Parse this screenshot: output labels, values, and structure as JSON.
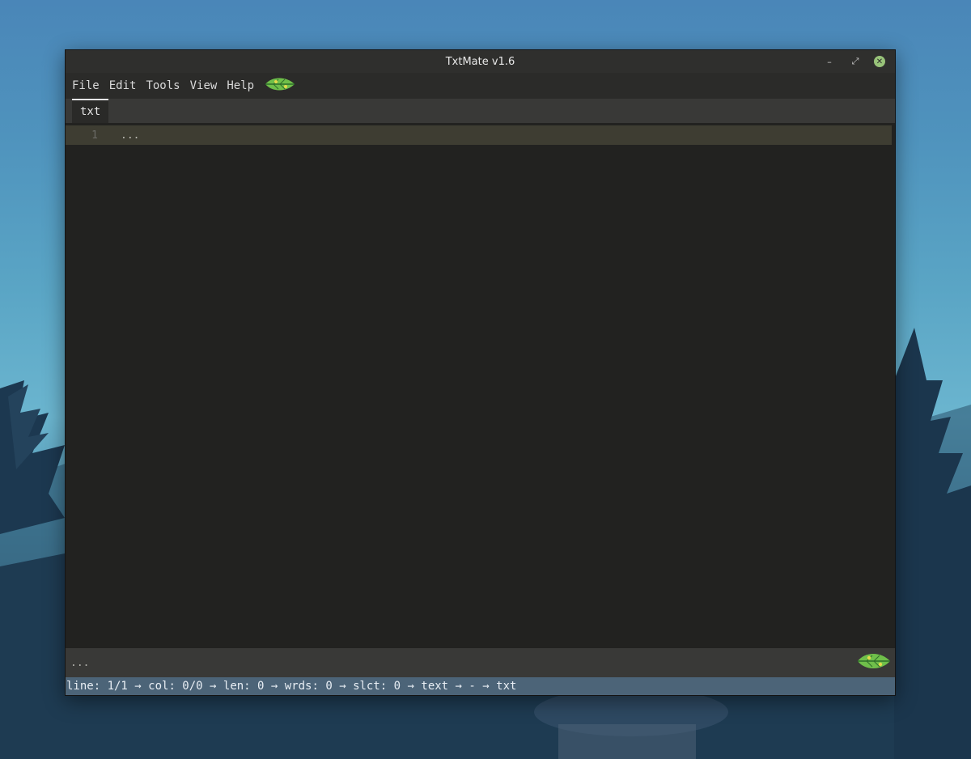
{
  "window": {
    "title": "TxtMate v1.6"
  },
  "wm": {
    "minimize": "–",
    "restore": "⤢",
    "close": "✕"
  },
  "menu": {
    "items": [
      "File",
      "Edit",
      "Tools",
      "View",
      "Help"
    ]
  },
  "tabs": [
    {
      "label": "txt"
    }
  ],
  "editor": {
    "line_number": "1",
    "line_text": "..."
  },
  "command_bar": {
    "text": "..."
  },
  "status": {
    "line": "line: 1/1",
    "col": "col: 0/0",
    "len": "len: 0",
    "words": "wrds: 0",
    "select": "slct: 0",
    "mode": "text",
    "dash": "-",
    "ext": "txt",
    "sep": " → "
  },
  "icons": {
    "logo": "leaf-icon"
  },
  "colors": {
    "accent_green": "#98c379",
    "status_bg": "#4c6478",
    "current_line": "#3e3d32"
  }
}
